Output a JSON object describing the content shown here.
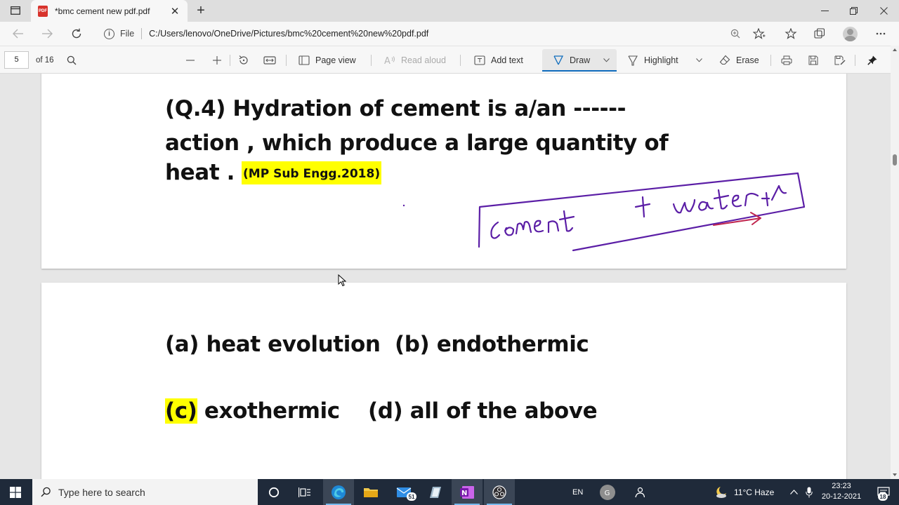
{
  "browser": {
    "tab_title": "*bmc cement new pdf.pdf",
    "tab_close": "✕",
    "new_tab": "+",
    "file_label": "File",
    "url": "C:/Users/lenovo/OneDrive/Pictures/bmc%20cement%20new%20pdf.pdf"
  },
  "pdf_toolbar": {
    "page_number": "5",
    "page_total": "of 16",
    "page_view": "Page view",
    "read_aloud": "Read aloud",
    "add_text": "Add text",
    "draw": "Draw",
    "highlight": "Highlight",
    "erase": "Erase"
  },
  "document": {
    "question_line1": "(Q.4) Hydration of cement is a/an ------",
    "question_line2": "action , which produce a large quantity of",
    "question_line3": "heat .",
    "source_tag": "(MP Sub Engg.2018)",
    "option_a": "(a) heat evolution",
    "option_b": "(b) endothermic",
    "option_c_label": "(c)",
    "option_c_text": " exothermic",
    "option_d": "(d) all of the above",
    "annotation_text": "cement + water",
    "ink_color": "#5b1ea6",
    "ink_arrow_color": "#c0244d",
    "highlight_color": "#ffff00"
  },
  "taskbar": {
    "search_placeholder": "Type here to search",
    "mail_badge": "51",
    "language": "EN",
    "weather": "11°C  Haze",
    "time": "23:23",
    "date": "20-12-2021",
    "notification_count": "18"
  }
}
